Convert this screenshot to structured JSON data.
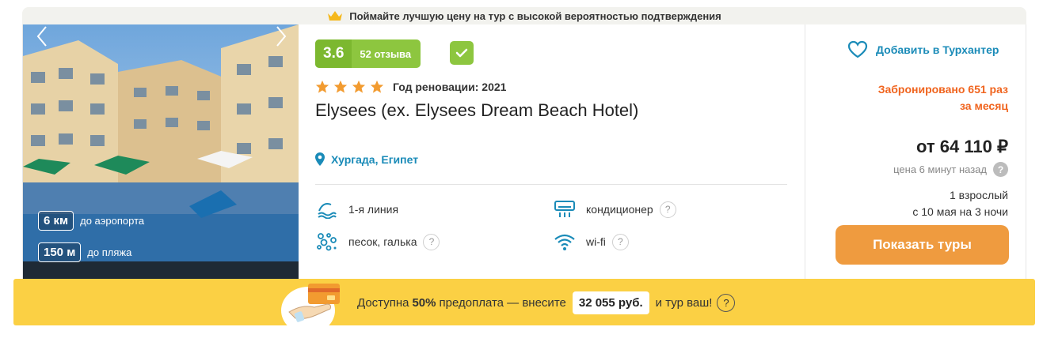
{
  "banner": {
    "text": "Поймайте лучшую цену на тур с высокой вероятностью подтверждения",
    "icon": "crown-icon"
  },
  "photo": {
    "distances": [
      {
        "value": "6 км",
        "label": "до аэропорта"
      },
      {
        "value": "150 м",
        "label": "до пляжа"
      }
    ]
  },
  "hotel": {
    "rating": "3.6",
    "reviews": "52 отзыва",
    "stars": 4,
    "renovation": "Год реновации: 2021",
    "name": "Elysees (ex. Elysees Dream Beach Hotel)",
    "location": "Хургада, Египет"
  },
  "amenities": [
    {
      "label": "1-я линия",
      "icon": "beach-line-icon",
      "help": ""
    },
    {
      "label": "кондиционер",
      "icon": "air-conditioner-icon",
      "help": "?"
    },
    {
      "label": "песок, галька",
      "icon": "sand-pebbles-icon",
      "help": "?"
    },
    {
      "label": "wi-fi",
      "icon": "wifi-icon",
      "help": "?"
    }
  ],
  "sidebar": {
    "favorite": "Добавить в Турхантер",
    "booked_line1": "Забронировано 651 раз",
    "booked_line2": "за месяц",
    "price": "от 64 110 ₽",
    "price_age": "цена 6 минут назад",
    "price_help": "?",
    "pax": "1 взрослый",
    "dates": "с 10 мая на 3 ночи",
    "button": "Показать туры"
  },
  "footer": {
    "prefix": "Доступна",
    "percent": "50%",
    "middle": "предоплата — внесите",
    "amount": "32 055 руб.",
    "suffix": "и тур ваш!",
    "help": "?"
  },
  "colors": {
    "accent_green": "#8dc63f",
    "link_blue": "#1a8bb8",
    "orange": "#f0641e",
    "button": "#ef9b3f",
    "footer_yellow": "#fbd044"
  }
}
